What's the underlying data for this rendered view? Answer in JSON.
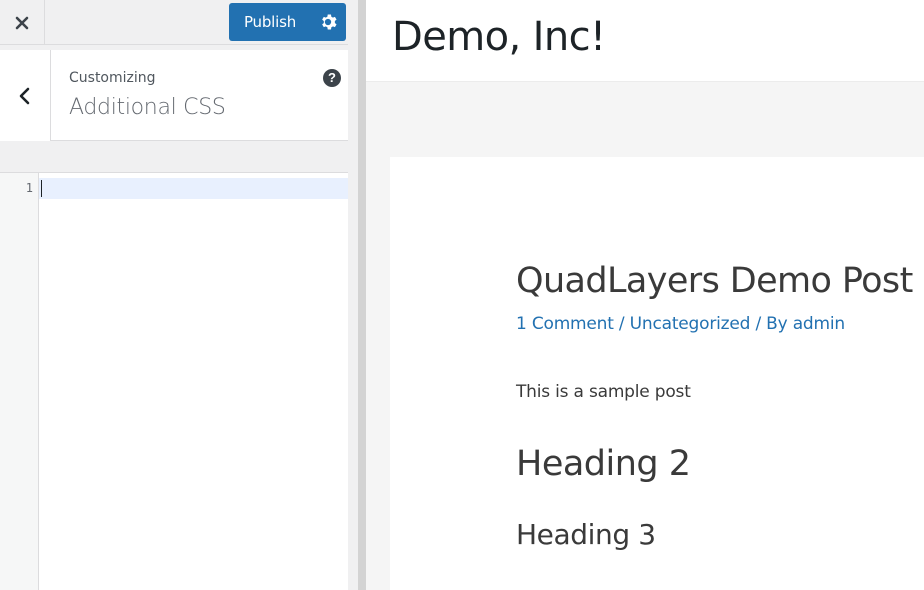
{
  "topbar": {
    "close_icon": "close-icon",
    "publish_label": "Publish",
    "settings_icon": "gear-icon",
    "publish_color": "#2271b1"
  },
  "section": {
    "breadcrumb": "Customizing",
    "title": "Additional CSS",
    "back_icon": "chevron-left-icon",
    "help_label": "?"
  },
  "editor": {
    "line_numbers": [
      "1"
    ],
    "content": ""
  },
  "preview": {
    "site_title": "Demo, Inc!",
    "post": {
      "title": "QuadLayers Demo Post",
      "meta": {
        "comments": "1 Comment",
        "sep1": " / ",
        "category": "Uncategorized",
        "sep2": " / By ",
        "author": "admin"
      },
      "body": "This is a sample post",
      "heading2": "Heading 2",
      "heading3": "Heading 3"
    },
    "link_color": "#2271b1"
  }
}
